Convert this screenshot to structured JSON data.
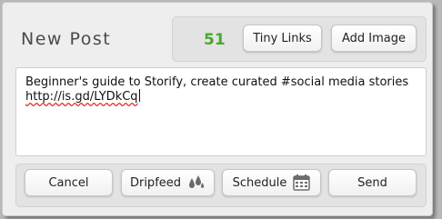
{
  "post": {
    "title": "New Post",
    "char_count": "51"
  },
  "toolbar": {
    "tiny_links_label": "Tiny Links",
    "add_image_label": "Add Image"
  },
  "composer": {
    "line1": "Beginner's guide to Storify, create curated #social media stories",
    "line2": "http://is.gd/LYDkCq"
  },
  "actions": {
    "cancel_label": "Cancel",
    "dripfeed_label": "Dripfeed",
    "schedule_label": "Schedule",
    "send_label": "Send"
  },
  "icons": {
    "dripfeed": "water-drops-icon",
    "schedule": "calendar-icon"
  },
  "colors": {
    "counter": "#4aa72a",
    "panel_bg": "#eeeeee",
    "button_bg": "#ffffff"
  }
}
